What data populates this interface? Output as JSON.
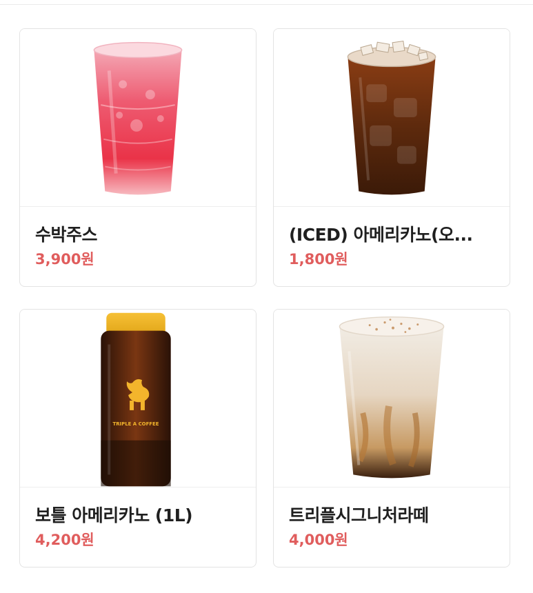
{
  "accent_price_color": "#e05d5d",
  "products": [
    {
      "name": "수박주스",
      "price": "3,900원",
      "image": "red-iced-juice-cup"
    },
    {
      "name": "(ICED) 아메리카노(오...",
      "price": "1,800원",
      "image": "iced-americano-cup"
    },
    {
      "name": "보틀 아메리카노 (1L)",
      "price": "4,200원",
      "image": "americano-bottle",
      "bottle_label": "TRIPLE A COFFEE"
    },
    {
      "name": "트리플시그니처라떼",
      "price": "4,000원",
      "image": "signature-latte-cup"
    }
  ]
}
